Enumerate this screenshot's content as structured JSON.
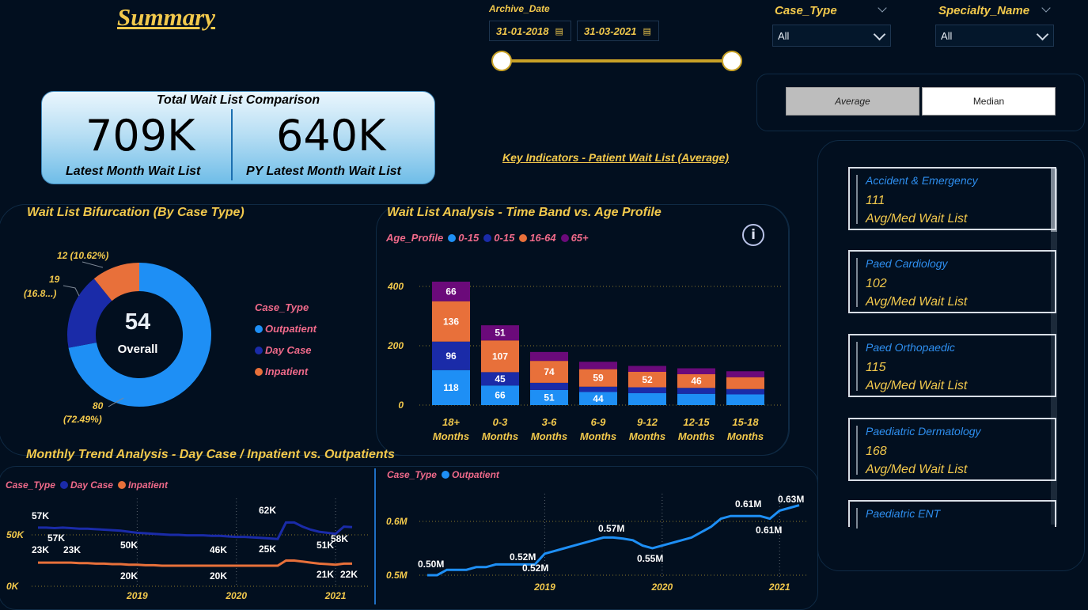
{
  "page_title": "Summary",
  "archive_date": {
    "label": "Archive_Date",
    "start": "31-01-2018",
    "end": "31-03-2021"
  },
  "case_type_slicer": {
    "label": "Case_Type",
    "value": "All"
  },
  "specialty_slicer": {
    "label": "Specialty_Name",
    "value": "All"
  },
  "toggle": {
    "average": "Average",
    "median": "Median",
    "selected": "Average"
  },
  "kpi": {
    "title": "Total Wait List Comparison",
    "latest_value": "709K",
    "latest_label": "Latest Month Wait List",
    "py_value": "640K",
    "py_label": "PY Latest Month Wait List"
  },
  "key_indicators_title": "Key Indicators - Patient Wait List (Average)",
  "specialty_cards": [
    {
      "name": "Accident & Emergency",
      "value": "111",
      "label": "Avg/Med Wait List"
    },
    {
      "name": "Paed Cardiology",
      "value": "102",
      "label": "Avg/Med Wait List"
    },
    {
      "name": "Paed Orthopaedic",
      "value": "115",
      "label": "Avg/Med Wait List"
    },
    {
      "name": "Paediatric Dermatology",
      "value": "168",
      "label": "Avg/Med Wait List"
    },
    {
      "name": "Paediatric ENT",
      "value": "",
      "label": ""
    }
  ],
  "donut": {
    "title": "Wait List Bifurcation (By Case Type)",
    "center_value": "54",
    "center_label": "Overall",
    "legend_title": "Case_Type",
    "slice_labels": {
      "outpatient": [
        "80",
        "(72.49%)"
      ],
      "daycase": [
        "19",
        "(16.8...)"
      ],
      "inpatient": [
        "12 (10.62%)"
      ]
    }
  },
  "bar_chart": {
    "title": "Wait List Analysis - Time Band vs. Age Profile",
    "legend_title": "Age_Profile",
    "info_icon": "info-circle-icon"
  },
  "trend": {
    "title": "Monthly Trend Analysis - Day Case / Inpatient vs. Outpatients",
    "left_legend_title": "Case_Type",
    "right_legend_title": "Case_Type"
  },
  "colors": {
    "outpatient": "#1e8ff5",
    "daycase": "#1a2ba8",
    "inpatient": "#e8703a",
    "age65": "#6b0a7a",
    "gold": "#f2c94c",
    "label_pink": "#f06a8a"
  },
  "chart_data": [
    {
      "type": "pie",
      "title": "Wait List Bifurcation (By Case Type)",
      "categories": [
        "Outpatient",
        "Day Case",
        "Inpatient"
      ],
      "values": [
        80,
        19,
        12
      ],
      "percent_labels": [
        "72.49%",
        "16.8...",
        "10.62%"
      ],
      "legend": "right"
    },
    {
      "type": "bar",
      "stacked": true,
      "title": "Wait List Analysis - Time Band vs. Age Profile",
      "categories": [
        "18+ Months",
        "0-3 Months",
        "3-6 Months",
        "6-9 Months",
        "9-12 Months",
        "12-15 Months",
        "15-18 Months"
      ],
      "series": [
        {
          "name": "0-15",
          "color": "#1e8ff5",
          "values": [
            118,
            66,
            51,
            44,
            40,
            38,
            36
          ],
          "labels": [
            "118",
            "66",
            "51",
            "44",
            "",
            "",
            ""
          ]
        },
        {
          "name": "0-15",
          "color": "#1a2ba8",
          "values": [
            96,
            45,
            24,
            18,
            20,
            20,
            18
          ],
          "labels": [
            "96",
            "45",
            "",
            "",
            "",
            "",
            ""
          ]
        },
        {
          "name": "16-64",
          "color": "#e8703a",
          "values": [
            136,
            107,
            74,
            59,
            52,
            46,
            40
          ],
          "labels": [
            "136",
            "107",
            "74",
            "59",
            "52",
            "46",
            ""
          ]
        },
        {
          "name": "65+",
          "color": "#6b0a7a",
          "values": [
            66,
            51,
            30,
            25,
            20,
            20,
            20
          ],
          "labels": [
            "66",
            "51",
            "",
            "",
            "",
            "",
            ""
          ]
        }
      ],
      "yticks": [
        0,
        200,
        400
      ],
      "ylim": [
        0,
        440
      ],
      "legend": "top-left"
    },
    {
      "type": "line",
      "title": "Day Case / Inpatient",
      "x": [
        "2018-01",
        "2018-02",
        "2018-03",
        "2018-04",
        "2018-05",
        "2018-06",
        "2018-07",
        "2018-08",
        "2018-09",
        "2018-10",
        "2018-11",
        "2018-12",
        "2019-01",
        "2019-02",
        "2019-03",
        "2019-04",
        "2019-05",
        "2019-06",
        "2019-07",
        "2019-08",
        "2019-09",
        "2019-10",
        "2019-11",
        "2019-12",
        "2020-01",
        "2020-02",
        "2020-03",
        "2020-04",
        "2020-05",
        "2020-06",
        "2020-07",
        "2020-08",
        "2020-09",
        "2020-10",
        "2020-11",
        "2020-12",
        "2021-01",
        "2021-02",
        "2021-03"
      ],
      "series": [
        {
          "name": "Day Case",
          "color": "#1a2ba8",
          "values": [
            57,
            57,
            56.5,
            57,
            56.5,
            56,
            56,
            55.5,
            55,
            54.5,
            54,
            53,
            52,
            51.5,
            51,
            50.5,
            50,
            50,
            49.5,
            49.5,
            49.5,
            49,
            49,
            48.5,
            48,
            48,
            47.5,
            47,
            46.5,
            46,
            62,
            62,
            58,
            55,
            53,
            52,
            51,
            58,
            57.5
          ]
        },
        {
          "name": "Inpatient",
          "color": "#e8703a",
          "values": [
            23,
            23,
            23,
            23,
            23,
            22.5,
            22.5,
            22,
            22,
            21.5,
            21.5,
            21,
            21,
            20.5,
            20.5,
            20,
            20,
            20,
            20,
            20,
            20,
            20,
            20,
            20,
            20,
            20,
            20,
            20,
            20,
            20,
            25,
            25,
            24,
            23,
            22,
            21.5,
            21,
            22,
            22
          ]
        }
      ],
      "point_labels": [
        "57K",
        "57K",
        "23K",
        "23K",
        "50K",
        "20K",
        "46K",
        "20K",
        "62K",
        "25K",
        "51K",
        "21K",
        "58K",
        "22K"
      ],
      "yticks": [
        "0K",
        "50K"
      ],
      "xticks": [
        "2019",
        "2020",
        "2021"
      ],
      "ylim": [
        0,
        70
      ],
      "legend": "top-left"
    },
    {
      "type": "line",
      "title": "Outpatient",
      "x": [
        "2018-01",
        "2018-02",
        "2018-03",
        "2018-04",
        "2018-05",
        "2018-06",
        "2018-07",
        "2018-08",
        "2018-09",
        "2018-10",
        "2018-11",
        "2018-12",
        "2019-01",
        "2019-02",
        "2019-03",
        "2019-04",
        "2019-05",
        "2019-06",
        "2019-07",
        "2019-08",
        "2019-09",
        "2019-10",
        "2019-11",
        "2019-12",
        "2020-01",
        "2020-02",
        "2020-03",
        "2020-04",
        "2020-05",
        "2020-06",
        "2020-07",
        "2020-08",
        "2020-09",
        "2020-10",
        "2020-11",
        "2020-12",
        "2021-01",
        "2021-02",
        "2021-03"
      ],
      "series": [
        {
          "name": "Outpatient",
          "color": "#1e8ff5",
          "values": [
            0.5,
            0.5,
            0.51,
            0.51,
            0.51,
            0.515,
            0.515,
            0.52,
            0.52,
            0.52,
            0.52,
            0.52,
            0.54,
            0.545,
            0.55,
            0.555,
            0.56,
            0.565,
            0.57,
            0.57,
            0.568,
            0.565,
            0.555,
            0.55,
            0.555,
            0.56,
            0.565,
            0.57,
            0.58,
            0.59,
            0.605,
            0.61,
            0.61,
            0.61,
            0.61,
            0.605,
            0.62,
            0.625,
            0.63
          ]
        }
      ],
      "point_labels": [
        "0.50M",
        "0.52M",
        "0.52M",
        "0.57M",
        "0.55M",
        "0.61M",
        "0.61M",
        "0.63M"
      ],
      "yticks": [
        "0.5M",
        "0.6M"
      ],
      "xticks": [
        "2019",
        "2020",
        "2021"
      ],
      "ylim": [
        0.49,
        0.65
      ],
      "legend": "top-left"
    }
  ]
}
